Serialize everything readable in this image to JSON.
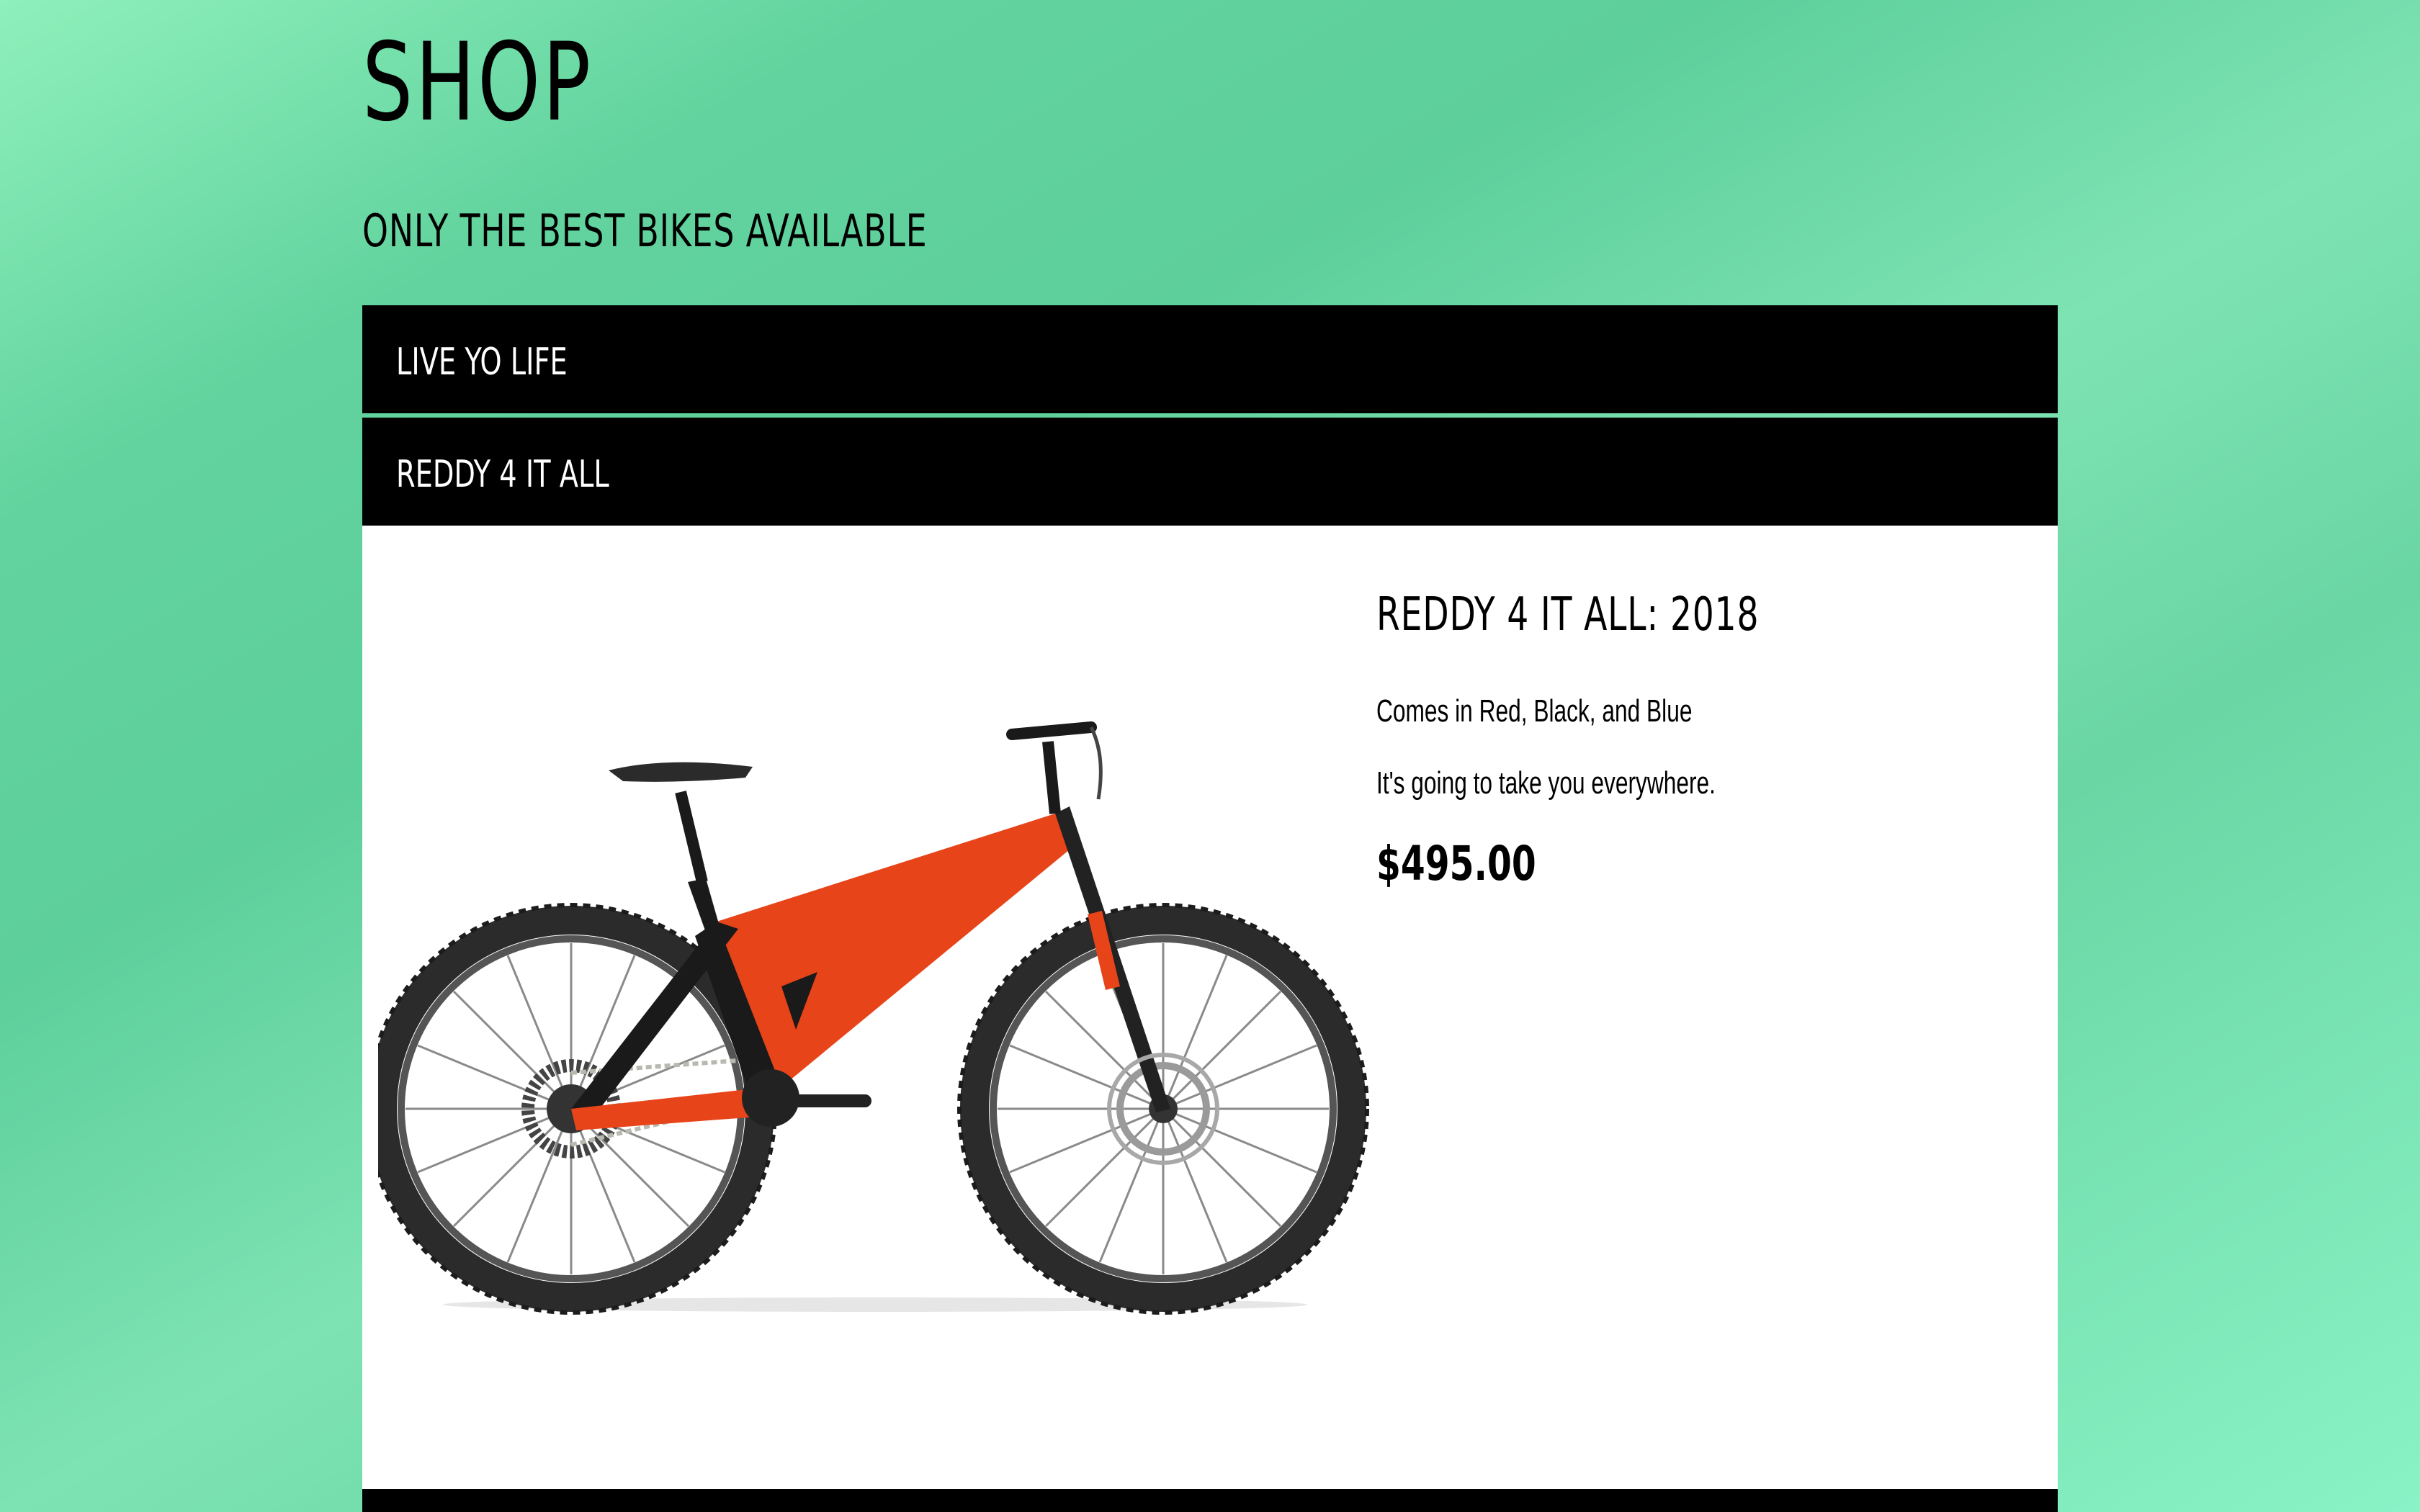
{
  "page": {
    "title": "SHOP",
    "subtitle": "ONLY THE BEST BIKES AVAILABLE"
  },
  "accordion": {
    "items": [
      {
        "label": "LIVE YO LIFE",
        "expanded": false
      },
      {
        "label": "REDDY 4 IT ALL",
        "expanded": true
      },
      {
        "label": "",
        "expanded": false
      }
    ]
  },
  "product": {
    "title": "REDDY 4 IT ALL: 2018",
    "description_lines": [
      "Comes in Red, Black, and Blue",
      "It's going to take you everywhere."
    ],
    "price": "$495.00",
    "image_icon": "mountain-bike-image"
  },
  "colors": {
    "header_bg": "#000000",
    "header_text": "#ffffff",
    "panel_bg": "#ffffff",
    "frame_orange": "#e8441a",
    "frame_black": "#1a1a1a"
  }
}
